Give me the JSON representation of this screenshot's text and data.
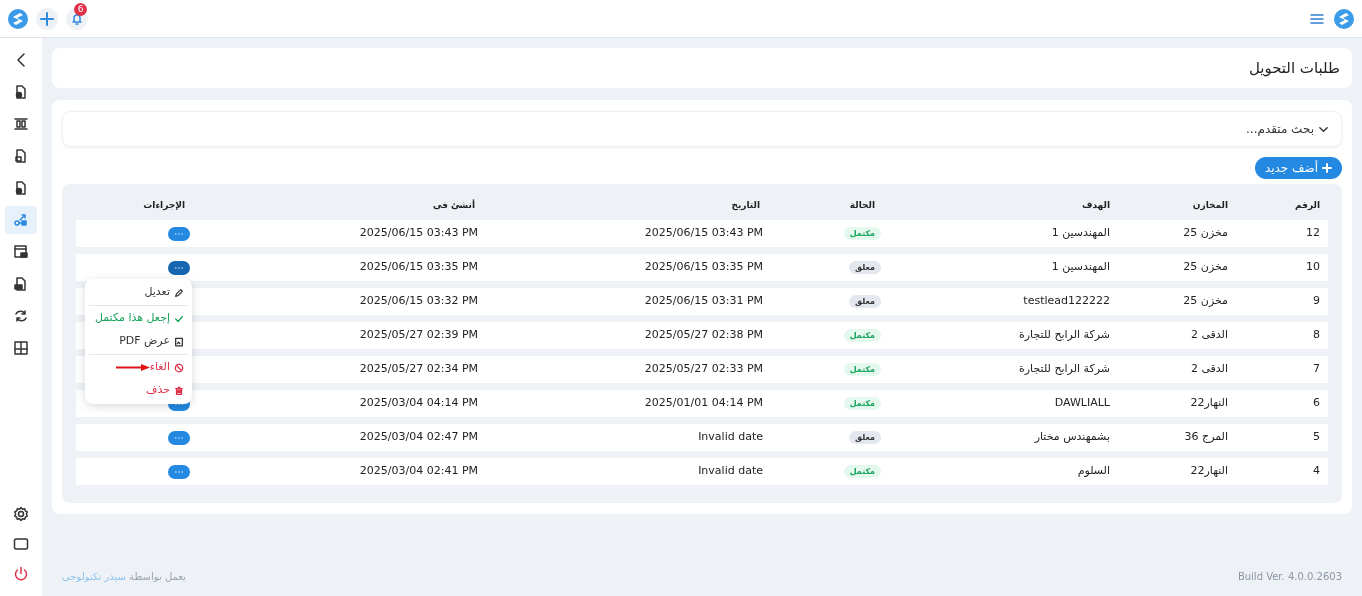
{
  "topbar": {
    "notification_count": "6"
  },
  "sidebar": {
    "items": [
      {
        "selected": false
      },
      {
        "selected": false
      },
      {
        "selected": false
      },
      {
        "selected": false
      },
      {
        "selected": true
      },
      {
        "selected": false
      },
      {
        "selected": false
      },
      {
        "selected": false
      },
      {
        "selected": false
      }
    ]
  },
  "page_title": "طلبات التحويل",
  "advanced_search": {
    "label": "بحث متقدم...",
    "expanded": false
  },
  "add_button": "أضف جديد",
  "table": {
    "columns": [
      "الرقم",
      "المخازن",
      "الهدف",
      "الحالة",
      "التاريخ",
      "أنشئ فى",
      "الإجراءات"
    ],
    "rows": [
      {
        "number": "12",
        "store": "مخزن 25",
        "target": "المهندسين 1",
        "status": "مكتمل",
        "kind": "complete",
        "date": "2025/06/15 03:43 PM",
        "created": "2025/06/15 03:43 PM",
        "menu_open": false
      },
      {
        "number": "10",
        "store": "مخزن 25",
        "target": "المهندسين 1",
        "status": "معلق",
        "kind": "pending",
        "date": "2025/06/15 03:35 PM",
        "created": "2025/06/15 03:35 PM",
        "menu_open": true
      },
      {
        "number": "9",
        "store": "مخزن 25",
        "target": "testlead122222",
        "status": "معلق",
        "kind": "pending",
        "date": "2025/06/15 03:31 PM",
        "created": "2025/06/15 03:32 PM",
        "menu_open": false
      },
      {
        "number": "8",
        "store": "الدقى 2",
        "target": "شركة الرابح للتجارة",
        "status": "مكتمل",
        "kind": "complete",
        "date": "2025/05/27 02:38 PM",
        "created": "2025/05/27 02:39 PM",
        "menu_open": false
      },
      {
        "number": "7",
        "store": "الدقى 2",
        "target": "شركة الرابح للتجارة",
        "status": "مكتمل",
        "kind": "complete",
        "date": "2025/05/27 02:33 PM",
        "created": "2025/05/27 02:34 PM",
        "menu_open": false
      },
      {
        "number": "6",
        "store": "النهار22",
        "target": "DAWLIALL",
        "status": "مكتمل",
        "kind": "complete",
        "date": "2025/01/01 04:14 PM",
        "created": "2025/03/04 04:14 PM",
        "menu_open": false
      },
      {
        "number": "5",
        "store": "المرج 36",
        "target": "بشمهندس مختار",
        "status": "معلق",
        "kind": "pending",
        "date": "Invalid date",
        "created": "2025/03/04 02:47 PM",
        "menu_open": false
      },
      {
        "number": "4",
        "store": "النهار22",
        "target": "السلوم",
        "status": "مكتمل",
        "kind": "complete",
        "date": "Invalid date",
        "created": "2025/03/04 02:41 PM",
        "menu_open": false
      }
    ]
  },
  "action_menu": {
    "items": [
      {
        "kind": "edit",
        "label": "تعديل",
        "divider_after": true
      },
      {
        "kind": "complete",
        "label": "إجعل هذا مكتمل",
        "divider_after": false
      },
      {
        "kind": "pdf",
        "label": "عرض PDF",
        "divider_after": true
      },
      {
        "kind": "cancel",
        "label": "الغاء",
        "divider_after": false
      },
      {
        "kind": "delete",
        "label": "حذف",
        "divider_after": false
      }
    ]
  },
  "footer": {
    "powered_by": "يعمل بواسطة",
    "company": "سيدر تكنولوجى",
    "build": "Build Ver. 4.0.0.2603"
  }
}
